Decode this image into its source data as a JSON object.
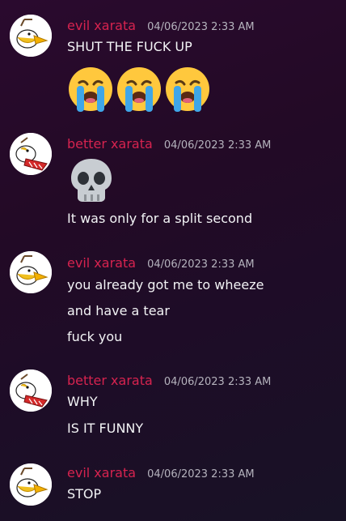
{
  "messages": [
    {
      "user": "evil xarata",
      "time": "04/06/2023 2:33 AM",
      "lines": [
        "SHUT THE FUCK UP"
      ],
      "emoji": [
        "loudly-crying-face",
        "loudly-crying-face",
        "loudly-crying-face"
      ]
    },
    {
      "user": "better xarata",
      "time": "04/06/2023 2:33 AM",
      "emoji": [
        "skull"
      ],
      "lines": [
        "It was only for a split second"
      ]
    },
    {
      "user": "evil xarata",
      "time": "04/06/2023 2:33 AM",
      "lines": [
        "you already got me to wheeze",
        "and have a tear",
        "fuck you"
      ]
    },
    {
      "user": "better xarata",
      "time": "04/06/2023 2:33 AM",
      "lines": [
        "WHY",
        "IS IT FUNNY"
      ]
    },
    {
      "user": "evil xarata",
      "time": "04/06/2023 2:33 AM",
      "lines": [
        "STOP"
      ]
    }
  ],
  "colors": {
    "username": "#d6234f",
    "timestamp": "#b5b3bd",
    "text": "#f2f3f5",
    "background": "#230a26"
  }
}
